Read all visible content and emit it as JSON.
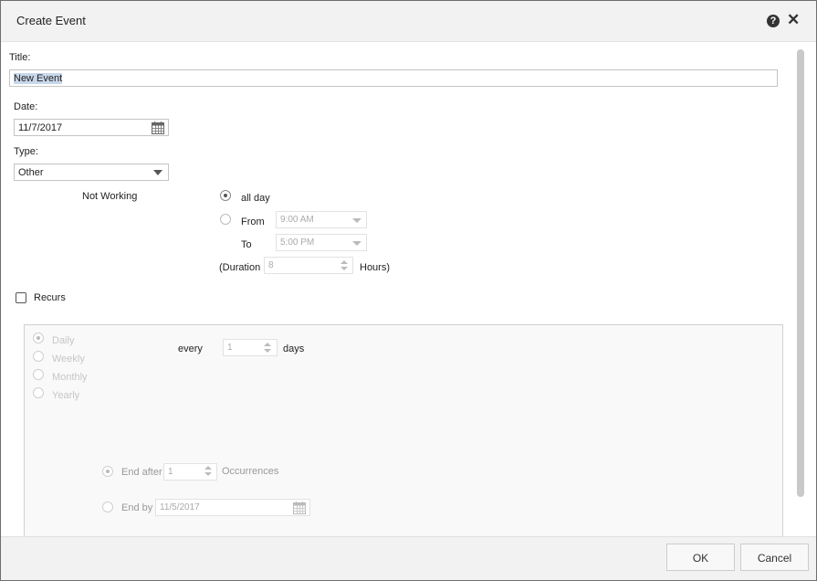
{
  "dialog": {
    "title": "Create Event"
  },
  "icons": {
    "help": "help-icon",
    "close": "close-icon",
    "calendar": "calendar-icon"
  },
  "form": {
    "title_label": "Title:",
    "title_value": "New Event",
    "date_label": "Date:",
    "date_value": "11/7/2017",
    "type_label": "Type:",
    "type_value": "Other",
    "not_working_label": "Not Working",
    "all_day_label": "all day",
    "all_day_checked": true,
    "from_label": "From",
    "from_value": "9:00 AM",
    "to_label": "To",
    "to_value": "5:00 PM",
    "duration_label": "(Duration",
    "duration_value": "8",
    "hours_label": "Hours)"
  },
  "recurs": {
    "label": "Recurs",
    "checked": false,
    "options": [
      "Daily",
      "Weekly",
      "Monthly",
      "Yearly"
    ],
    "selected": "Daily",
    "every_label": "every",
    "every_value": "1",
    "days_label": "days",
    "end_after_label": "End after",
    "end_after_value": "1",
    "occurrences_label": "Occurrences",
    "end_by_label": "End by",
    "end_by_value": "11/5/2017"
  },
  "footer": {
    "ok_label": "OK",
    "cancel_label": "Cancel"
  }
}
